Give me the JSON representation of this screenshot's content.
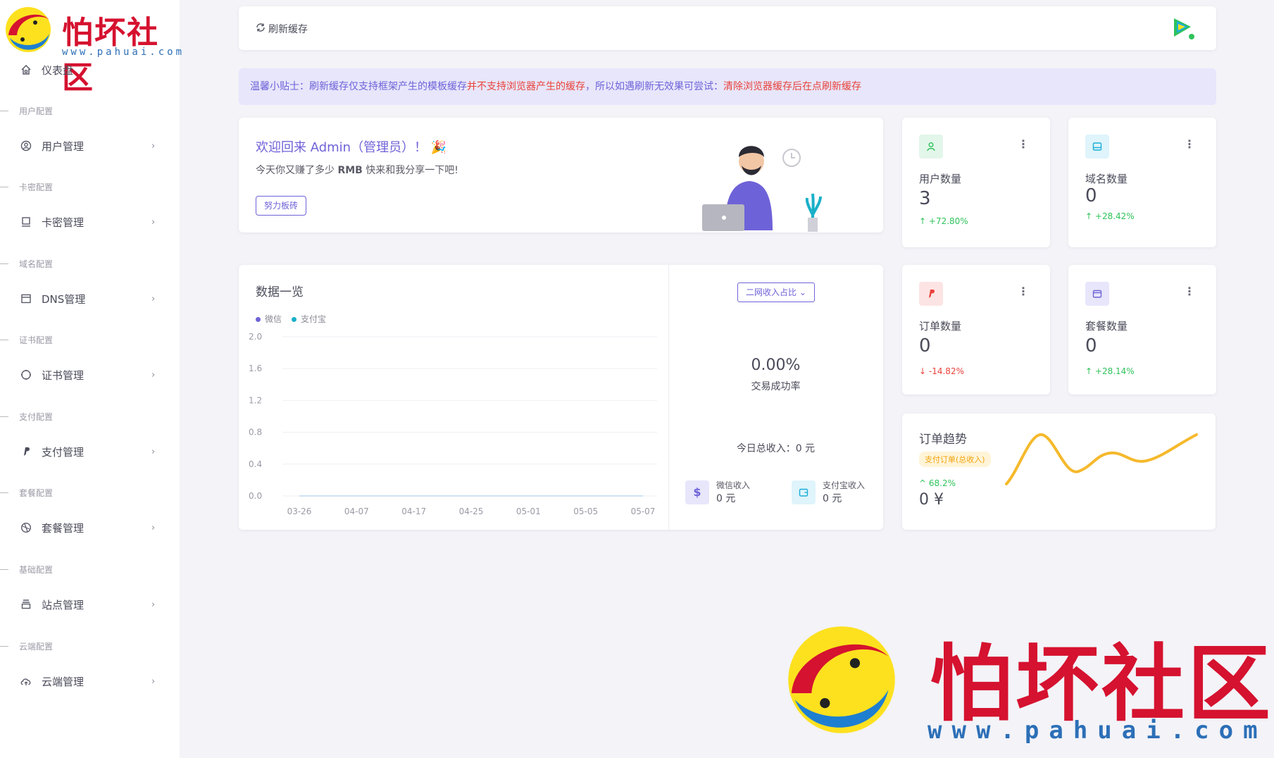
{
  "logo": {
    "name": "怕坏社区",
    "url": "www.pahuai.com"
  },
  "sidebar": {
    "dashboard": {
      "label": "仪表盘",
      "icon": "home-icon"
    },
    "sections": [
      {
        "title": "用户配置",
        "item": {
          "label": "用户管理",
          "icon": "user-icon"
        }
      },
      {
        "title": "卡密配置",
        "item": {
          "label": "卡密管理",
          "icon": "monitor-icon"
        }
      },
      {
        "title": "域名配置",
        "item": {
          "label": "DNS管理",
          "icon": "window-icon"
        }
      },
      {
        "title": "证书配置",
        "item": {
          "label": "证书管理",
          "icon": "cert-icon"
        }
      },
      {
        "title": "支付配置",
        "item": {
          "label": "支付管理",
          "icon": "paypal-icon"
        }
      },
      {
        "title": "套餐配置",
        "item": {
          "label": "套餐管理",
          "icon": "package-icon"
        }
      },
      {
        "title": "基础配置",
        "item": {
          "label": "站点管理",
          "icon": "site-icon"
        }
      },
      {
        "title": "云端配置",
        "item": {
          "label": "云端管理",
          "icon": "cloud-icon"
        }
      }
    ]
  },
  "topbar": {
    "refresh_label": "刷新缓存"
  },
  "tip": {
    "part1": "温馨小贴士：刷新缓存仅支持框架产生的模板缓存",
    "part2": "并不支持浏览器产生的缓存",
    "part3": "，所以如遇刷新无效果可尝试：",
    "part4": "清除浏览器缓存后在点刷新缓存"
  },
  "welcome": {
    "title": "欢迎回来 Admin（管理员）！",
    "subtitle_pre": "今天你又赚了多少 ",
    "subtitle_bold": "RMB",
    "subtitle_post": " 快来和我分享一下吧!",
    "button": "努力板砖"
  },
  "stats": [
    {
      "label": "用户数量",
      "value": "3",
      "delta": "+72.80%",
      "dir": "up",
      "icon": "user-icon",
      "bg": "#e3f6ea",
      "color": "#2fc25b"
    },
    {
      "label": "域名数量",
      "value": "0",
      "delta": "+28.42%",
      "dir": "up",
      "icon": "hdd-icon",
      "bg": "#dff4fb",
      "color": "#1aaed8"
    },
    {
      "label": "订单数量",
      "value": "0",
      "delta": "-14.82%",
      "dir": "down",
      "icon": "paypal-icon",
      "bg": "#fde4e4",
      "color": "#e9423a"
    },
    {
      "label": "套餐数量",
      "value": "0",
      "delta": "+28.14%",
      "dir": "up",
      "icon": "wallet-icon",
      "bg": "#e7e6fb",
      "color": "#6e62d8"
    }
  ],
  "data_overview": {
    "title": "数据一览",
    "legend": [
      {
        "name": "微信",
        "color": "#6e62d8"
      },
      {
        "name": "支付宝",
        "color": "#1ab0c8"
      }
    ],
    "select": "二网收入占比",
    "rate_value": "0.00%",
    "rate_label": "交易成功率",
    "total_label": "今日总收入：0 元",
    "wechat_label": "微信收入",
    "wechat_value": "0 元",
    "alipay_label": "支付宝收入",
    "alipay_value": "0 元"
  },
  "chart_data": {
    "type": "line",
    "categories": [
      "03-26",
      "04-07",
      "04-17",
      "04-25",
      "05-01",
      "05-05",
      "05-07"
    ],
    "series": [
      {
        "name": "微信",
        "values": [
          0,
          0,
          0,
          0,
          0,
          0,
          0
        ]
      },
      {
        "name": "支付宝",
        "values": [
          0,
          0,
          0,
          0,
          0,
          0,
          0
        ]
      }
    ],
    "yticks": [
      "2.0",
      "1.6",
      "1.2",
      "0.8",
      "0.4",
      "0.0"
    ],
    "ylim": [
      0,
      2.0
    ]
  },
  "trend": {
    "title": "订单趋势",
    "badge": "支付订单(总收入)",
    "delta": "68.2%",
    "value": "0 ¥",
    "color": "#f5b92c"
  },
  "watermark": {
    "name": "怕坏社区",
    "url": "www.pahuai.com"
  }
}
